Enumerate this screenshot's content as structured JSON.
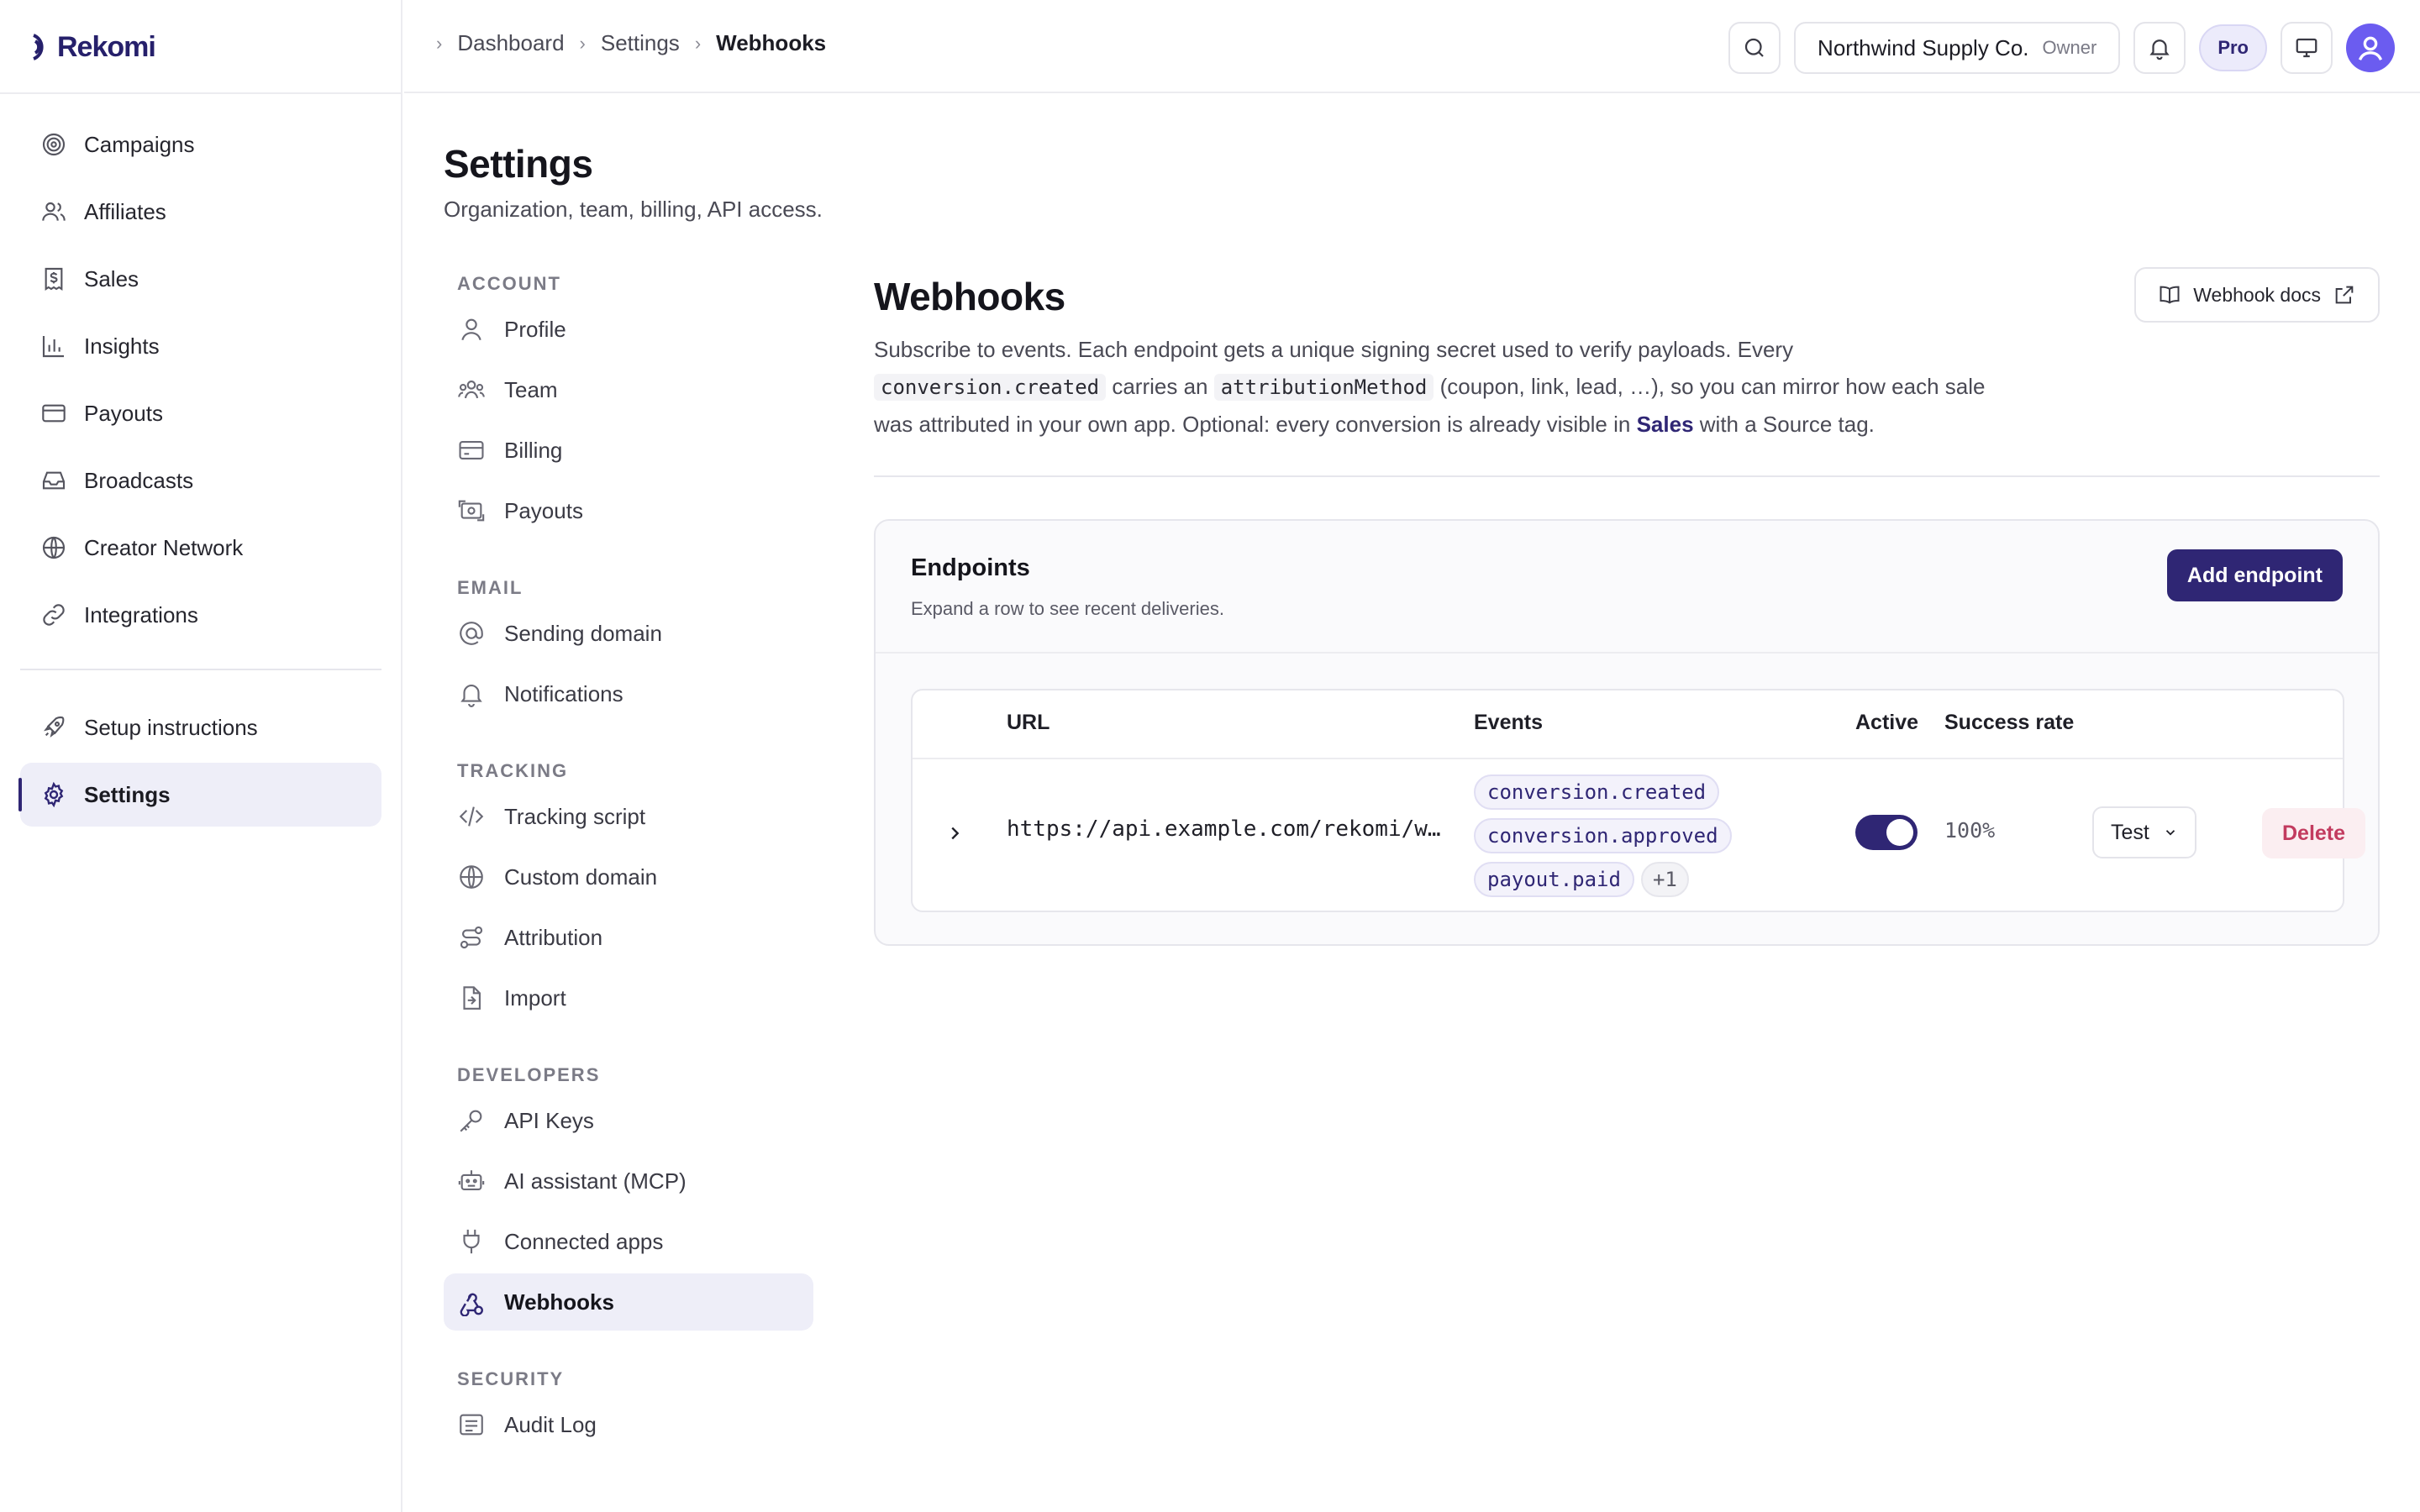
{
  "app": {
    "name": "Rekomi"
  },
  "sidebar": {
    "items": [
      {
        "label": "Campaigns",
        "icon": "target-icon"
      },
      {
        "label": "Affiliates",
        "icon": "users-icon"
      },
      {
        "label": "Sales",
        "icon": "receipt-icon"
      },
      {
        "label": "Insights",
        "icon": "bar-chart-icon"
      },
      {
        "label": "Payouts",
        "icon": "credit-card-icon"
      },
      {
        "label": "Broadcasts",
        "icon": "inbox-icon"
      },
      {
        "label": "Creator Network",
        "icon": "globe-icon"
      },
      {
        "label": "Integrations",
        "icon": "link-icon"
      }
    ],
    "bottom_items": [
      {
        "label": "Setup instructions",
        "icon": "rocket-icon"
      },
      {
        "label": "Settings",
        "icon": "gear-icon",
        "active": true
      }
    ]
  },
  "breadcrumb": [
    "Dashboard",
    "Settings",
    "Webhooks"
  ],
  "topbar": {
    "org_name": "Northwind Supply Co.",
    "org_role": "Owner",
    "plan_badge": "Pro"
  },
  "settings": {
    "title": "Settings",
    "subtitle": "Organization, team, billing, API access.",
    "sections": [
      {
        "heading": "ACCOUNT",
        "items": [
          "Profile",
          "Team",
          "Billing",
          "Payouts"
        ]
      },
      {
        "heading": "EMAIL",
        "items": [
          "Sending domain",
          "Notifications"
        ]
      },
      {
        "heading": "TRACKING",
        "items": [
          "Tracking script",
          "Custom domain",
          "Attribution",
          "Import"
        ]
      },
      {
        "heading": "DEVELOPERS",
        "items": [
          "API Keys",
          "AI assistant (MCP)",
          "Connected apps",
          "Webhooks"
        ]
      },
      {
        "heading": "SECURITY",
        "items": [
          "Audit Log"
        ]
      }
    ],
    "active_item": "Webhooks"
  },
  "webhooks": {
    "title": "Webhooks",
    "docs_label": "Webhook docs",
    "desc_1": "Subscribe to events. Each endpoint gets a unique signing secret used to verify payloads. Every",
    "desc_code_1": "conversion.created",
    "desc_2": "carries an",
    "desc_code_2": "attributionMethod",
    "desc_3": "(coupon, link, lead, …), so you can mirror how each sale was attributed in your own app. Optional: every conversion is already visible in",
    "desc_link": "Sales",
    "desc_4": "with a Source tag.",
    "card": {
      "title": "Endpoints",
      "subtitle": "Expand a row to see recent deliveries.",
      "add_label": "Add endpoint",
      "columns": {
        "url": "URL",
        "events": "Events",
        "active": "Active",
        "success": "Success rate"
      },
      "rows": [
        {
          "url": "https://api.example.com/rekomi/w…",
          "events": [
            "conversion.created",
            "conversion.approved",
            "payout.paid"
          ],
          "more_events": "+1",
          "active": true,
          "success_rate": "100%",
          "test_label": "Test",
          "delete_label": "Delete"
        }
      ]
    }
  },
  "colors": {
    "brand": "#2f2674",
    "danger": "#c23b5f",
    "active_bg": "#eeeef8"
  }
}
